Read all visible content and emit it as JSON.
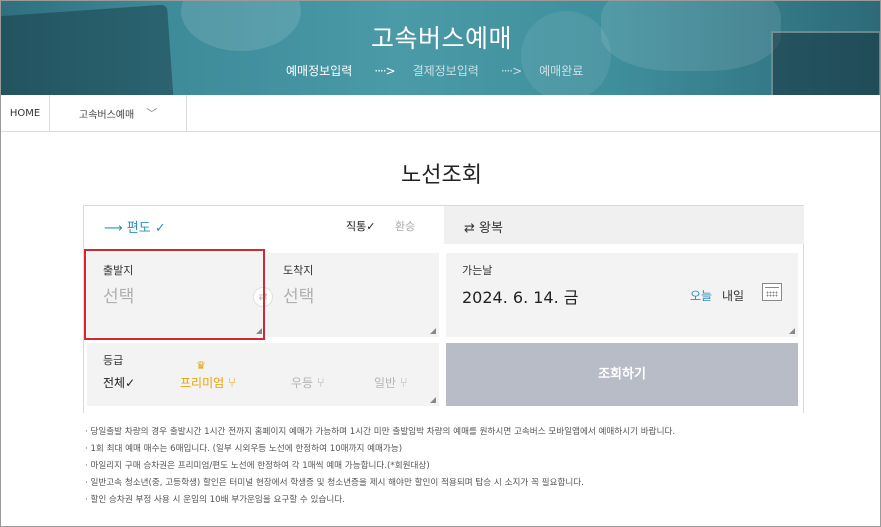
{
  "banner": {
    "title": "고속버스예매",
    "steps": [
      "예매정보입력",
      "결제정보입력",
      "예매완료"
    ],
    "active_step": 0
  },
  "breadcrumb": {
    "home": "HOME",
    "current": "고속버스예매"
  },
  "page_title": "노선조회",
  "trip_type": {
    "oneway_label": "편도 ✓",
    "oneway_icon": "arrow-right-icon",
    "direct_label": "직통✓",
    "transfer_label": "환승",
    "roundtrip_label": "왕복",
    "roundtrip_icon": "swap-arrows-icon"
  },
  "form": {
    "departure_label": "출발지",
    "departure_value": "선택",
    "arrival_label": "도착지",
    "arrival_value": "선택",
    "date_label": "가는날",
    "date_value": "2024. 6. 14. 금",
    "today_label": "오늘",
    "tomorrow_label": "내일",
    "grade_label": "등급",
    "grade_options": [
      "전체✓",
      "프리미엄",
      "우등",
      "일반"
    ],
    "search_button": "조회하기"
  },
  "notes": [
    "· 당일출발 차량의 경우 출발시간 1시간 전까지 홈페이지 예매가 가능하며 1시간 미만 출발임박 차량의 예매를 원하시면 고속버스 모바일앱에서 예매하시기 바랍니다.",
    "· 1회 최대 예매 매수는 6매입니다. (일부 시외우등 노선에 한정하여 10매까지 예매가능)",
    "· 마일리지 구매 승차권은 프리미엄/편도 노선에 한정하여 각 1매씩 예매 가능합니다.(*회원대상)",
    "· 일반고속 청소년(중, 고등학생) 할인은 터미널 현장에서 학생증 및 청소년증을 제시 해야만 할인이 적용되며 탑승 시 소지가 꼭 필요합니다.",
    "· 할인 승차권 부정 사용 시 운임의 10배 부가운임을 요구할 수 있습니다."
  ],
  "colors": {
    "accent": "#2a8fbf",
    "premium": "#e8a400",
    "highlight": "#d8262f",
    "search_button": "#b8bcc6"
  }
}
